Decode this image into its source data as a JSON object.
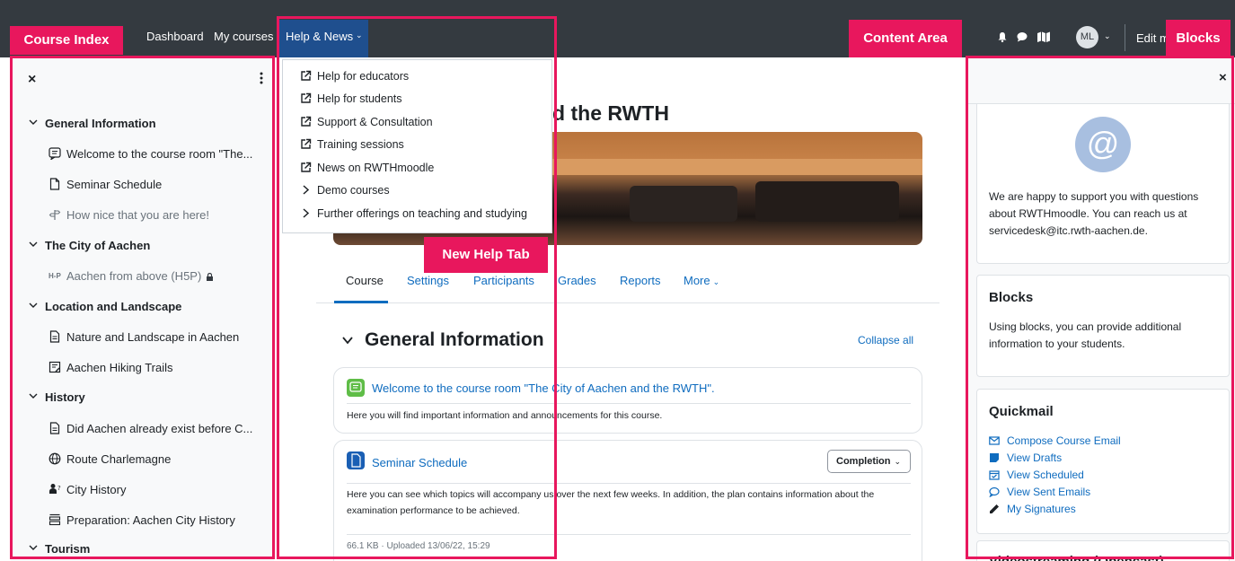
{
  "navbar": {
    "items": [
      "Dashboard",
      "My courses"
    ],
    "help_tab": "Help & News",
    "avatar_initials": "ML",
    "edit_mode": "Edit m",
    "icons": [
      "bell-icon",
      "chat-icon",
      "map-icon"
    ]
  },
  "annotations": {
    "course_index": "Course Index",
    "content_area": "Content Area",
    "blocks": "Blocks",
    "new_help_tab": "New Help Tab",
    "color": "#e8175d"
  },
  "help_menu": {
    "items": [
      {
        "label": "Help for educators",
        "icon": "external-link-icon"
      },
      {
        "label": "Help for students",
        "icon": "external-link-icon"
      },
      {
        "label": "Support & Consultation",
        "icon": "external-link-icon"
      },
      {
        "label": "Training sessions",
        "icon": "external-link-icon"
      },
      {
        "label": "News on RWTHmoodle",
        "icon": "external-link-icon"
      },
      {
        "label": "Demo courses",
        "icon": "chevron-right-icon"
      },
      {
        "label": "Further offerings on teaching and studying",
        "icon": "chevron-right-icon"
      }
    ]
  },
  "course_index": {
    "rows": [
      {
        "type": "section",
        "label": "General Information"
      },
      {
        "type": "item",
        "label": "Welcome to the course room \"The...",
        "icon": "forum-icon"
      },
      {
        "type": "item",
        "label": "Seminar Schedule",
        "icon": "file-icon"
      },
      {
        "type": "item",
        "label": "How nice that you are here!",
        "icon": "signpost-icon",
        "dim": true
      },
      {
        "type": "section",
        "label": "The City of Aachen"
      },
      {
        "type": "item",
        "label": "Aachen from above (H5P)",
        "icon": "h5p-icon",
        "dim": true,
        "locked": true
      },
      {
        "type": "section",
        "label": "Location and Landscape"
      },
      {
        "type": "item",
        "label": "Nature and Landscape in Aachen",
        "icon": "page-icon"
      },
      {
        "type": "item",
        "label": "Aachen Hiking Trails",
        "icon": "book-icon"
      },
      {
        "type": "section",
        "label": "History"
      },
      {
        "type": "item",
        "label": "Did Aachen already exist before C...",
        "icon": "page-icon"
      },
      {
        "type": "item",
        "label": "Route Charlemagne",
        "icon": "globe-icon"
      },
      {
        "type": "item",
        "label": "City History",
        "icon": "quiz-icon"
      },
      {
        "type": "item",
        "label": "Preparation: Aachen City History",
        "icon": "lesson-icon"
      },
      {
        "type": "section",
        "label": "Tourism"
      }
    ]
  },
  "main": {
    "title": "nd the RWTH",
    "tabs": [
      "Course",
      "Settings",
      "Participants",
      "Grades",
      "Reports",
      "More"
    ],
    "section_title": "General Information",
    "collapse_all": "Collapse all",
    "activities": [
      {
        "title": "Welcome to the course room \"The City of Aachen and the RWTH\".",
        "description": "Here you will find important information and announcements for this course.",
        "icon": "forum-icon",
        "icon_color": "#5fbd47"
      },
      {
        "title": "Seminar Schedule",
        "completion": "Completion",
        "description": "Here you can see which topics will accompany us over the next few weeks. In addition, the plan contains information about the examination performance to be achieved.",
        "meta": "66.1 KB · Uploaded 13/06/22, 15:29",
        "icon": "file-icon",
        "icon_color": "#1a5fb4"
      }
    ]
  },
  "blocks": {
    "contact": {
      "icon": "at-sign-icon",
      "text": "We are happy to support you with questions about RWTHmoodle. You can reach us at servicedesk@itc.rwth-aachen.de."
    },
    "blocks_card": {
      "title": "Blocks",
      "text": "Using blocks, you can provide additional information to your students."
    },
    "quickmail": {
      "title": "Quickmail",
      "items": [
        {
          "label": "Compose Course Email",
          "icon": "envelope-icon"
        },
        {
          "label": "View Drafts",
          "icon": "draft-icon"
        },
        {
          "label": "View Scheduled",
          "icon": "calendar-check-icon"
        },
        {
          "label": "View Sent Emails",
          "icon": "speech-bubble-icon"
        },
        {
          "label": "My Signatures",
          "icon": "pen-icon"
        }
      ]
    },
    "video": {
      "title": "Videostreaming (Opencast)"
    }
  }
}
